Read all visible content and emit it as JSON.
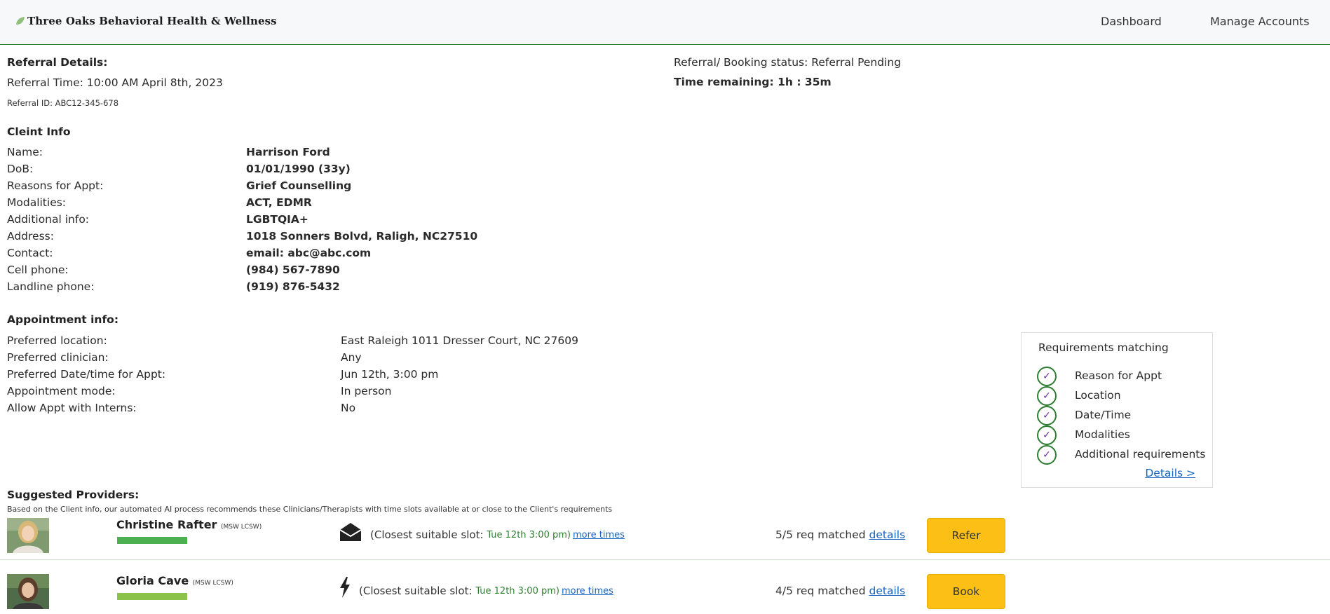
{
  "header": {
    "brand": "Three Oaks Behavioral Health & Wellness",
    "nav": [
      "Dashboard",
      "Manage Accounts"
    ]
  },
  "referral": {
    "heading": "Referral Details:",
    "time": "Referral Time: 10:00 AM April 8th, 2023",
    "id": "Referral ID: ABC12-345-678",
    "status": "Referral/ Booking status: Referral Pending",
    "remaining": "Time remaining: 1h : 35m"
  },
  "client": {
    "heading": "Cleint Info",
    "rows": [
      {
        "label": "Name:",
        "value": "Harrison Ford"
      },
      {
        "label": "DoB:",
        "value": "01/01/1990 (33y)"
      },
      {
        "label": "Reasons for Appt:",
        "value": "Grief Counselling"
      },
      {
        "label": "Modalities:",
        "value": "ACT, EDMR"
      },
      {
        "label": "Additional info:",
        "value": "LGBTQIA+"
      },
      {
        "label": "Address:",
        "value": "1018 Sonners Bolvd, Raligh, NC27510"
      },
      {
        "label": "Contact:",
        "value": "email: abc@abc.com"
      },
      {
        "label": "Cell phone:",
        "value": "(984) 567-7890"
      },
      {
        "label": "Landline phone:",
        "value": "(919) 876-5432"
      }
    ]
  },
  "appointment": {
    "heading": "Appointment info:",
    "rows": [
      {
        "label": "Preferred location:",
        "value": "East Raleigh 1011 Dresser Court, NC 27609"
      },
      {
        "label": "Preferred clinician:",
        "value": "Any"
      },
      {
        "label": "Preferred Date/time for Appt:",
        "value": "Jun 12th, 3:00 pm"
      },
      {
        "label": "Appointment mode:",
        "value": "In person"
      },
      {
        "label": "Allow Appt with Interns:",
        "value": "No"
      }
    ]
  },
  "requirements": {
    "title": "Requirements matching",
    "items": [
      "Reason for Appt",
      "Location",
      "Date/Time",
      "Modalities",
      "Additional requirements"
    ],
    "details_link": "Details >"
  },
  "providers": {
    "heading": "Suggested Providers:",
    "subtitle": "Based on the Client info, our automated AI process recommends these Clinicians/Therapists with time slots available at or close to the Client's requirements",
    "list": [
      {
        "name": "Christine Rafter",
        "credentials": "(MSW LCSW)",
        "bar_color": "#4caf50",
        "mode_icon": "envelope-open-icon",
        "slot_prefix": "(Closest suitable slot:",
        "slot_time": "Tue 12th 3:00 pm)",
        "more_times": "more times",
        "matched": "5/5 req matched",
        "details": "details",
        "action": "Refer"
      },
      {
        "name": "Gloria Cave",
        "credentials": "(MSW LCSW)",
        "bar_color": "#8bc34a",
        "mode_icon": "lightning-bolt-icon",
        "slot_prefix": "(Closest suitable slot:",
        "slot_time": "Tue 12th 3:00 pm)",
        "more_times": "more times",
        "matched": "4/5 req matched",
        "details": "details",
        "action": "Book"
      }
    ]
  }
}
